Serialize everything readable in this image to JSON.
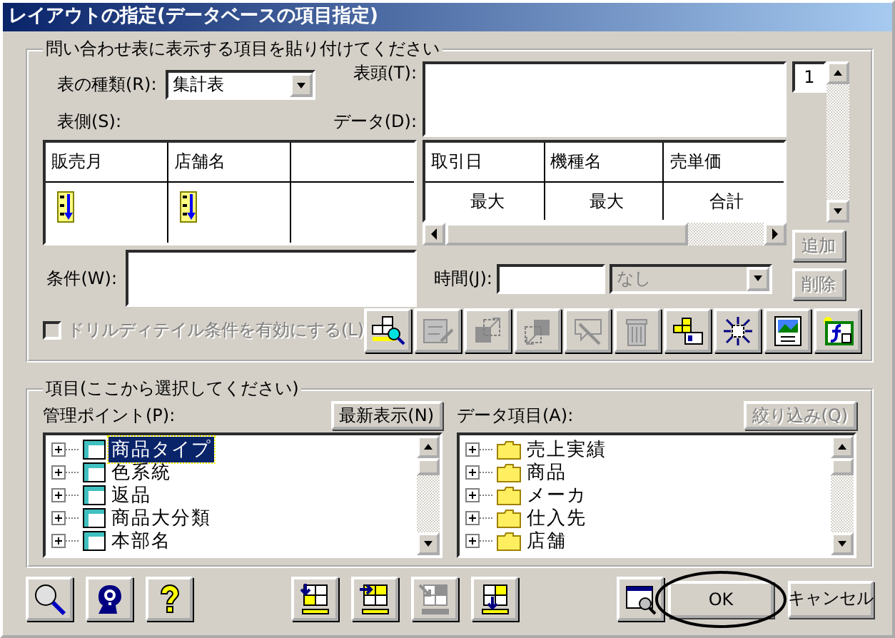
{
  "window": {
    "title": "レイアウトの指定(データベースの項目指定)"
  },
  "layout_group": {
    "legend": "問い合わせ表に表示する項目を貼り付けてください",
    "table_type": {
      "label": "表の種類(R):",
      "value": "集計表"
    },
    "row_axis": {
      "label": "表側(S):",
      "columns": [
        {
          "header": "販売月",
          "sorted": true
        },
        {
          "header": "店舗名",
          "sorted": true
        }
      ]
    },
    "column_axis": {
      "label": "表頭(T):"
    },
    "data": {
      "label": "データ(D):",
      "columns": [
        {
          "header": "取引日",
          "aggregate": "最大"
        },
        {
          "header": "機種名",
          "aggregate": "最大"
        },
        {
          "header": "売単価",
          "aggregate": "合計"
        }
      ]
    },
    "page": {
      "value": "1"
    },
    "add_button": {
      "label": "追加",
      "disabled": true
    },
    "delete_button": {
      "label": "削除",
      "disabled": true
    },
    "condition": {
      "label": "条件(W):"
    },
    "time": {
      "label": "時間(J):",
      "select_value": "なし",
      "disabled": true
    },
    "drill_checkbox": {
      "label": "ドリルディテイル条件を有効にする(L)",
      "checked": false,
      "disabled": true
    },
    "toolbar": [
      {
        "disabled": false
      },
      {
        "disabled": true
      },
      {
        "disabled": true
      },
      {
        "disabled": true
      },
      {
        "disabled": true
      },
      {
        "disabled": true
      },
      {
        "disabled": false
      },
      {
        "disabled": false
      },
      {
        "disabled": false
      },
      {
        "disabled": false
      }
    ]
  },
  "items_group": {
    "legend": "項目(ここから選択してください)",
    "management_points": {
      "label": "管理ポイント(P):",
      "refresh_button": {
        "label": "最新表示(N)",
        "disabled": false
      },
      "items": [
        {
          "label": "商品タイプ",
          "selected": true
        },
        {
          "label": "色系統",
          "selected": false
        },
        {
          "label": "返品",
          "selected": false
        },
        {
          "label": "商品大分類",
          "selected": false
        },
        {
          "label": "本部名",
          "selected": false
        }
      ]
    },
    "data_items": {
      "label": "データ項目(A):",
      "filter_button": {
        "label": "絞り込み(Q)",
        "disabled": true
      },
      "items": [
        {
          "label": "売上実績",
          "selected": false
        },
        {
          "label": "商品",
          "selected": false
        },
        {
          "label": "メーカ",
          "selected": false
        },
        {
          "label": "仕入先",
          "selected": false
        },
        {
          "label": "店舗",
          "selected": false
        }
      ]
    }
  },
  "help_toolbar": [
    {
      "disabled": false
    },
    {
      "disabled": false
    },
    {
      "disabled": false
    }
  ],
  "paste_toolbar": [
    {
      "disabled": false
    },
    {
      "disabled": false
    },
    {
      "disabled": true
    },
    {
      "disabled": false
    }
  ],
  "preview_button": {
    "disabled": false
  },
  "ok_button": {
    "label": "OK",
    "circled": true
  },
  "cancel_button": {
    "label": "キャンセル"
  }
}
